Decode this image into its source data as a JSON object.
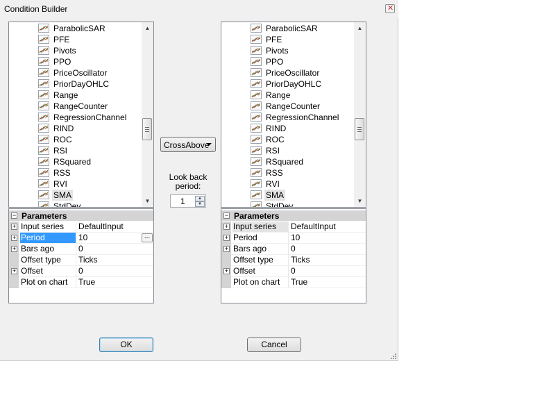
{
  "window": {
    "title": "Condition Builder",
    "close_icon": "close-icon"
  },
  "indicators": [
    "ParabolicSAR",
    "PFE",
    "Pivots",
    "PPO",
    "PriceOscillator",
    "PriorDayOHLC",
    "Range",
    "RangeCounter",
    "RegressionChannel",
    "RIND",
    "ROC",
    "RSI",
    "RSquared",
    "RSS",
    "RVI",
    "SMA",
    "StdDev"
  ],
  "left": {
    "selected": "SMA",
    "params": {
      "header": "Parameters",
      "rows": [
        {
          "name": "Input series",
          "value": "DefaultInput",
          "expandable": true,
          "state": "normal"
        },
        {
          "name": "Period",
          "value": "10",
          "expandable": true,
          "state": "highlight",
          "editor": "..."
        },
        {
          "name": "Bars ago",
          "value": "0",
          "expandable": true,
          "state": "normal"
        },
        {
          "name": "Offset type",
          "value": "Ticks",
          "expandable": false,
          "state": "normal"
        },
        {
          "name": "Offset",
          "value": "0",
          "expandable": true,
          "state": "normal"
        },
        {
          "name": "Plot on chart",
          "value": "True",
          "expandable": false,
          "state": "normal"
        }
      ]
    }
  },
  "right": {
    "selected": "SMA",
    "params": {
      "header": "Parameters",
      "rows": [
        {
          "name": "Input series",
          "value": "DefaultInput",
          "expandable": true,
          "state": "gray"
        },
        {
          "name": "Period",
          "value": "10",
          "expandable": true,
          "state": "normal"
        },
        {
          "name": "Bars ago",
          "value": "0",
          "expandable": true,
          "state": "normal"
        },
        {
          "name": "Offset type",
          "value": "Ticks",
          "expandable": false,
          "state": "normal"
        },
        {
          "name": "Offset",
          "value": "0",
          "expandable": true,
          "state": "normal"
        },
        {
          "name": "Plot on chart",
          "value": "True",
          "expandable": false,
          "state": "normal"
        }
      ]
    }
  },
  "center": {
    "operator": "CrossAbove",
    "lookback_label": "Look back period:",
    "lookback_value": "1"
  },
  "buttons": {
    "ok": "OK",
    "cancel": "Cancel"
  },
  "colors": {
    "selection": "#3399ff",
    "dialog_bg": "#f0f0f0"
  }
}
